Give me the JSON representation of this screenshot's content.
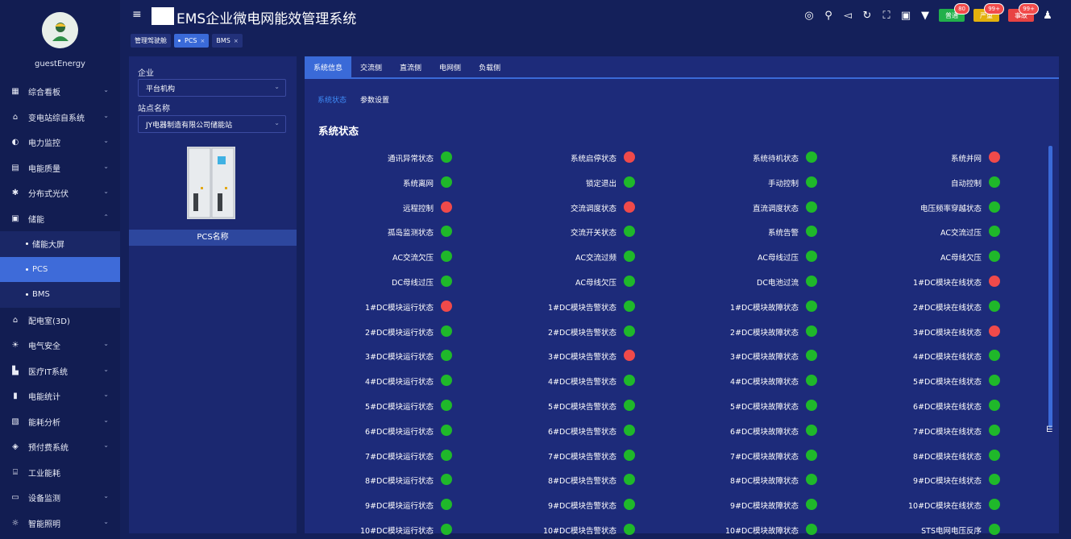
{
  "user": "guestEnergy",
  "app_title": "EMS企业微电网能效管理系统",
  "sidebar": [
    {
      "label": "综合看板",
      "icon": "dashboard-icon",
      "glyph": "▦",
      "chev": "⌄"
    },
    {
      "label": "变电站综自系统",
      "icon": "home-icon",
      "glyph": "⌂",
      "chev": "⌄"
    },
    {
      "label": "电力监控",
      "icon": "power-icon",
      "glyph": "◐",
      "chev": "⌄"
    },
    {
      "label": "电能质量",
      "icon": "quality-icon",
      "glyph": "▤",
      "chev": "⌄"
    },
    {
      "label": "分布式光伏",
      "icon": "solar-icon",
      "glyph": "✱",
      "chev": "⌄"
    },
    {
      "label": "储能",
      "icon": "storage-icon",
      "glyph": "▣",
      "chev": "⌃"
    },
    {
      "label": "储能大屏",
      "sub": true
    },
    {
      "label": "PCS",
      "sub": true,
      "active": true
    },
    {
      "label": "BMS",
      "sub": true
    },
    {
      "label": "配电室(3D)",
      "icon": "house-icon",
      "glyph": "⌂",
      "chev": ""
    },
    {
      "label": "电气安全",
      "icon": "safety-icon",
      "glyph": "☀",
      "chev": "⌄"
    },
    {
      "label": "医疗IT系统",
      "icon": "medical-icon",
      "glyph": "▙",
      "chev": "⌄"
    },
    {
      "label": "电能统计",
      "icon": "bar-chart-icon",
      "glyph": "▮",
      "chev": "⌄"
    },
    {
      "label": "能耗分析",
      "icon": "analysis-icon",
      "glyph": "▧",
      "chev": "⌄"
    },
    {
      "label": "预付费系统",
      "icon": "prepaid-icon",
      "glyph": "◈",
      "chev": "⌄"
    },
    {
      "label": "工业能耗",
      "icon": "industry-icon",
      "glyph": "⌸",
      "chev": ""
    },
    {
      "label": "设备监测",
      "icon": "monitor-icon",
      "glyph": "▭",
      "chev": "⌄"
    },
    {
      "label": "智能照明",
      "icon": "light-icon",
      "glyph": "☼",
      "chev": "⌄"
    }
  ],
  "header_icons": [
    "target-icon",
    "search-icon",
    "mute-icon",
    "refresh-icon",
    "fullscreen-icon",
    "translate-icon",
    "theme-icon"
  ],
  "alarms": [
    {
      "label": "普通",
      "count": "80",
      "color": "#22b04b"
    },
    {
      "label": "严重",
      "count": "99+",
      "color": "#e3b10d"
    },
    {
      "label": "事故",
      "count": "99+",
      "color": "#e84343"
    }
  ],
  "tabs": [
    {
      "label": "管理驾驶舱",
      "close": false,
      "active": false
    },
    {
      "label": "PCS",
      "close": true,
      "active": true
    },
    {
      "label": "BMS",
      "close": true,
      "active": false
    }
  ],
  "filter": {
    "company_label": "企业",
    "company_value": "平台机构",
    "station_label": "站点名称",
    "station_value": "JY电器制造有限公司储能站",
    "pcs_name": "PCS名称"
  },
  "main_tabs": [
    "系统信息",
    "交流侧",
    "直流侧",
    "电网侧",
    "负载侧"
  ],
  "sub_tabs": [
    "系统状态",
    "参数设置"
  ],
  "section_title": "系统状态",
  "colors": {
    "green": "#1fb82a",
    "red": "#f04a4a",
    "accent": "#3a6ad8"
  },
  "status_rows": [
    [
      [
        "通讯异常状态",
        "green"
      ],
      [
        "系统启停状态",
        "red"
      ],
      [
        "系统待机状态",
        "green"
      ],
      [
        "系统并网",
        "red"
      ]
    ],
    [
      [
        "系统离网",
        "green"
      ],
      [
        "锁定退出",
        "green"
      ],
      [
        "手动控制",
        "green"
      ],
      [
        "自动控制",
        "green"
      ]
    ],
    [
      [
        "远程控制",
        "red"
      ],
      [
        "交流调度状态",
        "red"
      ],
      [
        "直流调度状态",
        "green"
      ],
      [
        "电压频率穿越状态",
        "green"
      ]
    ],
    [
      [
        "孤岛监测状态",
        "green"
      ],
      [
        "交流开关状态",
        "green"
      ],
      [
        "系统告警",
        "green"
      ],
      [
        "AC交流过压",
        "green"
      ]
    ],
    [
      [
        "AC交流欠压",
        "green"
      ],
      [
        "AC交流过频",
        "green"
      ],
      [
        "AC母线过压",
        "green"
      ],
      [
        "AC母线欠压",
        "green"
      ]
    ],
    [
      [
        "DC母线过压",
        "green"
      ],
      [
        "AC母线欠压",
        "green"
      ],
      [
        "DC电池过流",
        "green"
      ],
      [
        "1#DC模块在线状态",
        "red"
      ]
    ],
    [
      [
        "1#DC模块运行状态",
        "red"
      ],
      [
        "1#DC模块告警状态",
        "green"
      ],
      [
        "1#DC模块故障状态",
        "green"
      ],
      [
        "2#DC模块在线状态",
        "green"
      ]
    ],
    [
      [
        "2#DC模块运行状态",
        "green"
      ],
      [
        "2#DC模块告警状态",
        "green"
      ],
      [
        "2#DC模块故障状态",
        "green"
      ],
      [
        "3#DC模块在线状态",
        "red"
      ]
    ],
    [
      [
        "3#DC模块运行状态",
        "green"
      ],
      [
        "3#DC模块告警状态",
        "red"
      ],
      [
        "3#DC模块故障状态",
        "green"
      ],
      [
        "4#DC模块在线状态",
        "green"
      ]
    ],
    [
      [
        "4#DC模块运行状态",
        "green"
      ],
      [
        "4#DC模块告警状态",
        "green"
      ],
      [
        "4#DC模块故障状态",
        "green"
      ],
      [
        "5#DC模块在线状态",
        "green"
      ]
    ],
    [
      [
        "5#DC模块运行状态",
        "green"
      ],
      [
        "5#DC模块告警状态",
        "green"
      ],
      [
        "5#DC模块故障状态",
        "green"
      ],
      [
        "6#DC模块在线状态",
        "green"
      ]
    ],
    [
      [
        "6#DC模块运行状态",
        "green"
      ],
      [
        "6#DC模块告警状态",
        "green"
      ],
      [
        "6#DC模块故障状态",
        "green"
      ],
      [
        "7#DC模块在线状态",
        "green"
      ]
    ],
    [
      [
        "7#DC模块运行状态",
        "green"
      ],
      [
        "7#DC模块告警状态",
        "green"
      ],
      [
        "7#DC模块故障状态",
        "green"
      ],
      [
        "8#DC模块在线状态",
        "green"
      ]
    ],
    [
      [
        "8#DC模块运行状态",
        "green"
      ],
      [
        "8#DC模块告警状态",
        "green"
      ],
      [
        "8#DC模块故障状态",
        "green"
      ],
      [
        "9#DC模块在线状态",
        "green"
      ]
    ],
    [
      [
        "9#DC模块运行状态",
        "green"
      ],
      [
        "9#DC模块告警状态",
        "green"
      ],
      [
        "9#DC模块故障状态",
        "green"
      ],
      [
        "10#DC模块在线状态",
        "green"
      ]
    ],
    [
      [
        "10#DC模块运行状态",
        "green"
      ],
      [
        "10#DC模块告警状态",
        "green"
      ],
      [
        "10#DC模块故障状态",
        "green"
      ],
      [
        "STS电网电压反序",
        "green"
      ]
    ]
  ]
}
